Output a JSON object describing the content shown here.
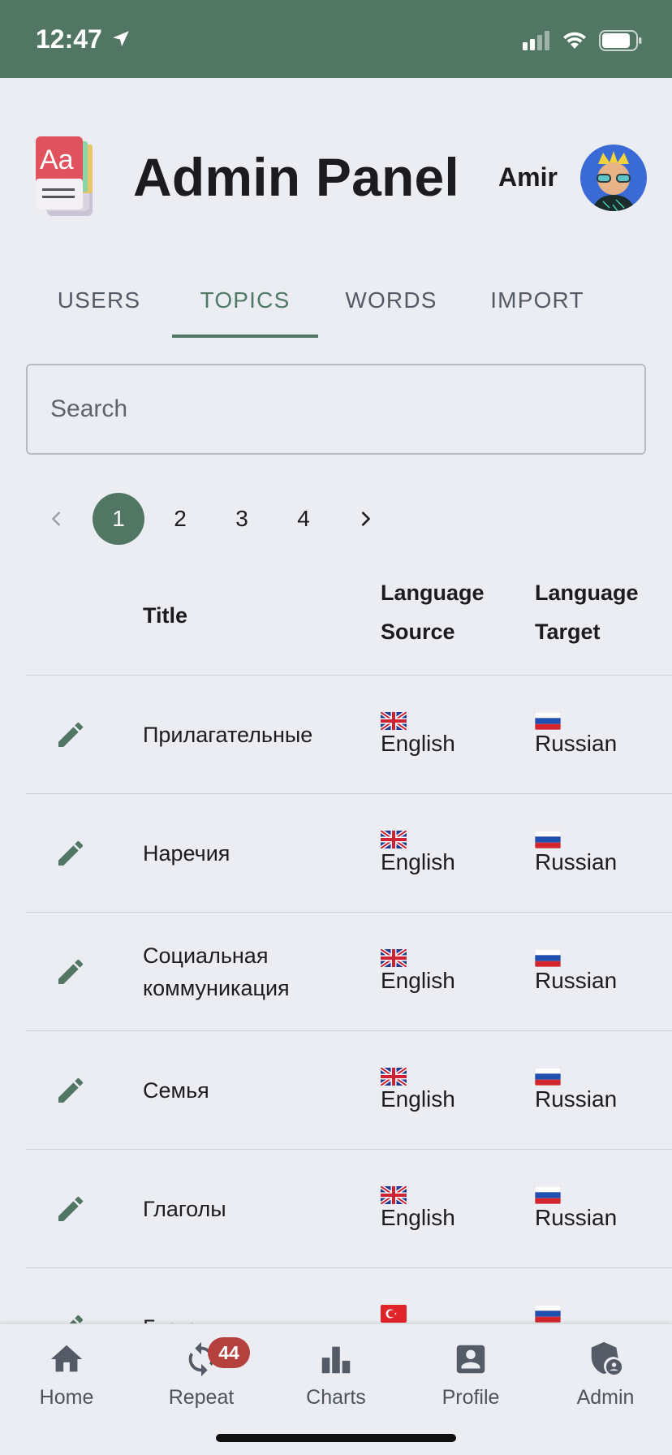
{
  "status_bar": {
    "time": "12:47"
  },
  "header": {
    "title": "Admin Panel",
    "user_name": "Amir"
  },
  "tabs": [
    {
      "label": "USERS",
      "active": false
    },
    {
      "label": "TOPICS",
      "active": true
    },
    {
      "label": "WORDS",
      "active": false
    },
    {
      "label": "IMPORT",
      "active": false
    }
  ],
  "search": {
    "placeholder": "Search",
    "value": ""
  },
  "pagination": {
    "pages": [
      "1",
      "2",
      "3",
      "4"
    ],
    "current": "1"
  },
  "table": {
    "headers": {
      "title": "Title",
      "source": "Language Source",
      "target": "Language Target"
    },
    "rows": [
      {
        "title": "Прилагательные",
        "source": "English",
        "source_flag": "gb-flag-icon",
        "target": "Russian",
        "target_flag": "ru-flag-icon"
      },
      {
        "title": "Наречия",
        "source": "English",
        "source_flag": "gb-flag-icon",
        "target": "Russian",
        "target_flag": "ru-flag-icon"
      },
      {
        "title": "Социальная коммуникация",
        "source": "English",
        "source_flag": "gb-flag-icon",
        "target": "Russian",
        "target_flag": "ru-flag-icon"
      },
      {
        "title": "Семья",
        "source": "English",
        "source_flag": "gb-flag-icon",
        "target": "Russian",
        "target_flag": "ru-flag-icon"
      },
      {
        "title": "Глаголы",
        "source": "English",
        "source_flag": "gb-flag-icon",
        "target": "Russian",
        "target_flag": "ru-flag-icon"
      },
      {
        "title": "Глаго",
        "source": "",
        "source_flag": "tr-flag-icon",
        "target": "",
        "target_flag": "ru-flag-icon"
      }
    ]
  },
  "bottom_nav": {
    "items": [
      {
        "label": "Home",
        "icon": "home-icon"
      },
      {
        "label": "Repeat",
        "icon": "repeat-icon",
        "badge": "44"
      },
      {
        "label": "Charts",
        "icon": "bar-chart-icon"
      },
      {
        "label": "Profile",
        "icon": "profile-icon"
      },
      {
        "label": "Admin",
        "icon": "admin-shield-icon"
      }
    ]
  },
  "colors": {
    "accent": "#527664",
    "badge": "#b5413f",
    "background": "#ebedf2"
  }
}
